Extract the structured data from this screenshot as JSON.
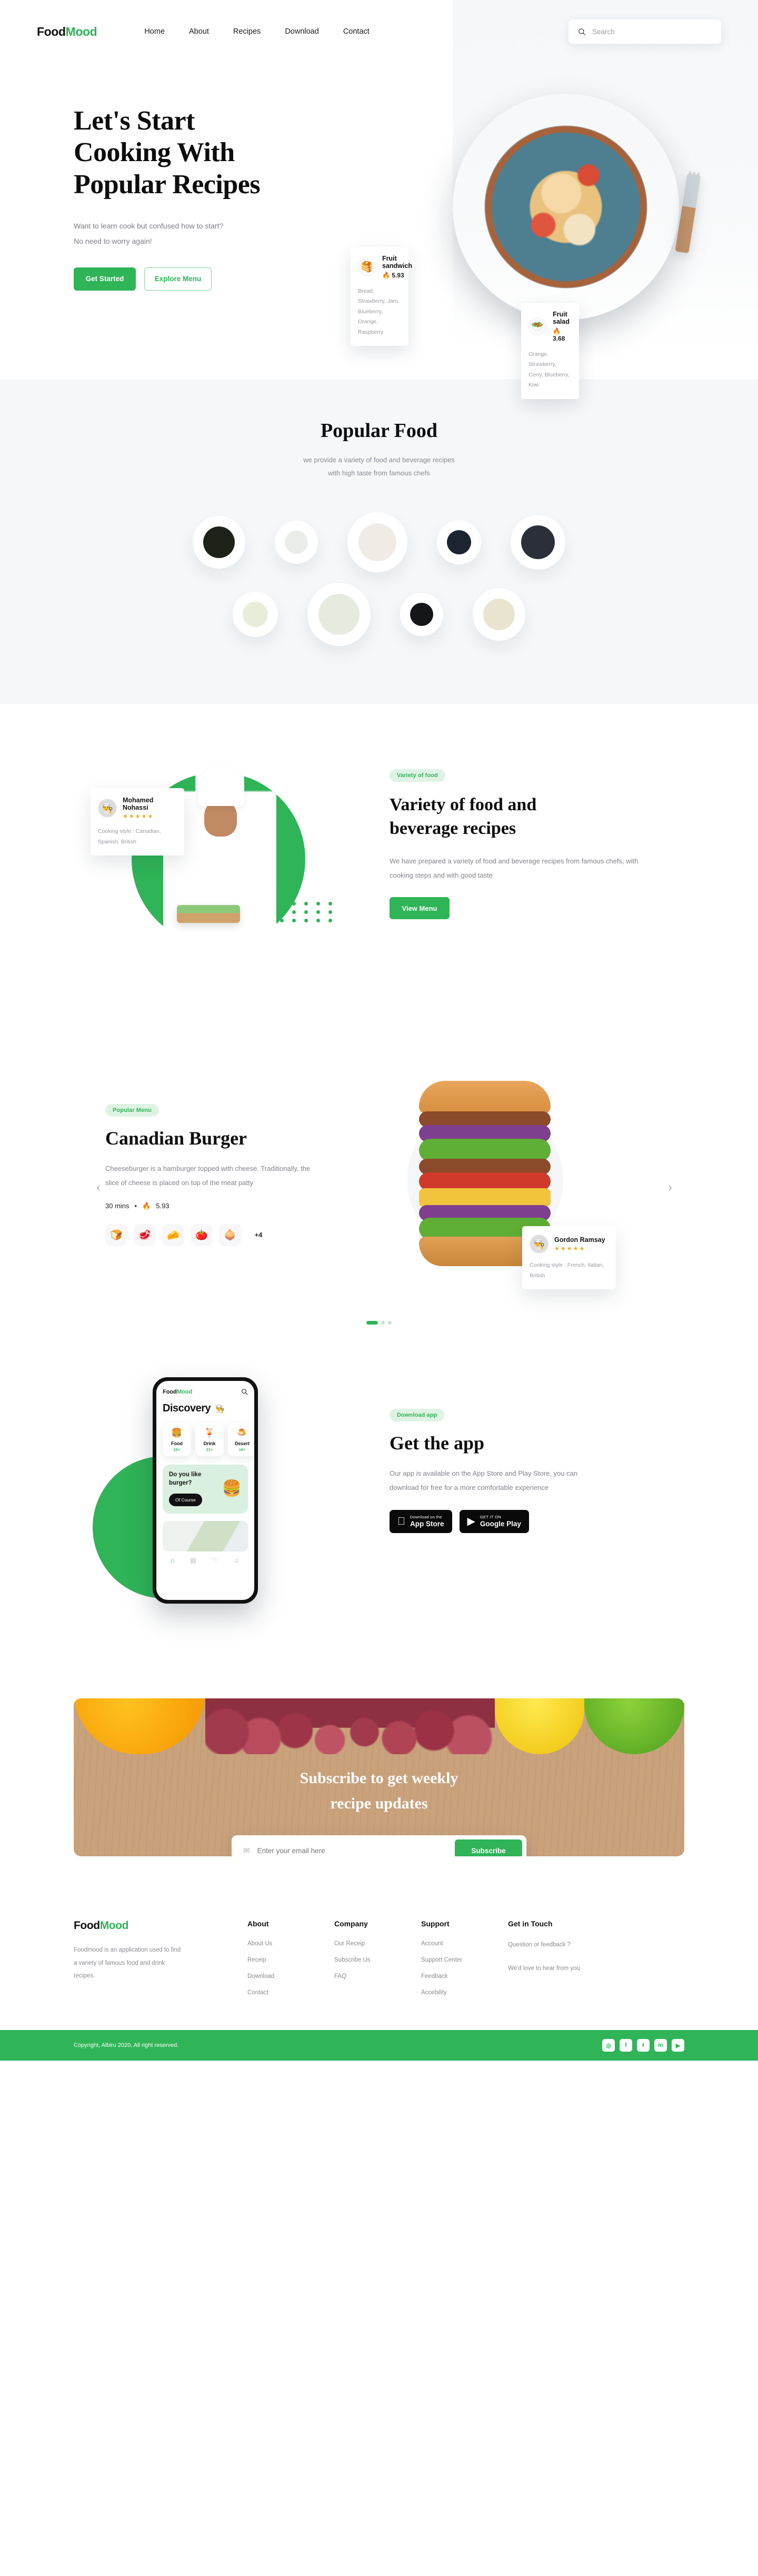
{
  "brand": {
    "part1": "Food",
    "part2": "Mood"
  },
  "nav": {
    "links": [
      "Home",
      "About",
      "Recipes",
      "Download",
      "Contact"
    ],
    "search_placeholder": "Search",
    "search_value": ""
  },
  "hero": {
    "title_line1": "Let's Start",
    "title_line2": "Cooking With",
    "title_line3": "Popular Recipes",
    "sub_line1": "Want to learn cook but confused how to start?",
    "sub_line2": "No need to worry again!",
    "primary_btn": "Get Started",
    "secondary_btn": "Explore Menu",
    "cards": [
      {
        "name": "Fruit sandwich",
        "rating": "5.93",
        "emoji": "🥞",
        "ingredients": "Bread, Strawberry, Jam, Blueberry, Orange, Raspberry"
      },
      {
        "name": "Fruit salad",
        "rating": "3.68",
        "emoji": "🥗",
        "ingredients": "Orange, Strawberry, Cerry, Blueberry, Kiwi"
      }
    ]
  },
  "popular": {
    "title": "Popular Food",
    "sub_line1": "we provide a variety of food and beverage recipes",
    "sub_line2": "with high taste from famous chefs",
    "row1": [
      {
        "name": "green-salad-dark-plate",
        "size": 72,
        "bg": "#1d2318",
        "size_inner": 60
      },
      {
        "name": "egg-salad-toast-plate",
        "size": 54,
        "bg": "#e9ece7",
        "size_inner": 44
      },
      {
        "name": "fig-fruit-plate",
        "size": 86,
        "bg": "#f0ece5",
        "size_inner": 72
      },
      {
        "name": "lentil-veg-bowl",
        "size": 56,
        "bg": "#1b2430",
        "size_inner": 46
      },
      {
        "name": "charcuterie-grape-plate",
        "size": 76,
        "bg": "#2a2f38",
        "size_inner": 64
      }
    ],
    "row2": [
      {
        "name": "avocado-cucumber-bowl",
        "size": 58,
        "bg": "#e7edd9",
        "size_inner": 48
      },
      {
        "name": "rainbow-veg-bowl",
        "size": 92,
        "bg": "#e6ebdf",
        "size_inner": 78
      },
      {
        "name": "waffle-dark-plate",
        "size": 54,
        "bg": "#14161a",
        "size_inner": 44
      },
      {
        "name": "stir-fry-noodles-plate",
        "size": 72,
        "bg": "#e8e4cf",
        "size_inner": 60
      }
    ]
  },
  "variety": {
    "badge": "Variety of food",
    "title_line1": "Variety of food and",
    "title_line2": "beverage recipes",
    "body": "We have prepared a variety of food and beverage recipes from famous chefs, with cooking steps and with good taste",
    "cta": "View Menu",
    "chef_card": {
      "name": "Mohamed Nohassi",
      "stars": "★★★★★",
      "cooking_style": "Cooking style : Canadian, Spanish, British",
      "avatar_emoji": "👨‍🍳"
    }
  },
  "burger": {
    "badge": "Popular Menu",
    "title": "Canadian Burger",
    "body": "Cheeseburger is a hamburger topped with cheese. Traditionally, the slice of cheese is placed on top of the meat patty",
    "time": "30 mins",
    "separator": "•",
    "rating": "5.93",
    "flame": "🔥",
    "ingredients": [
      "🍞",
      "🥩",
      "🧀",
      "🍅",
      "🧅"
    ],
    "more_label": "+4",
    "prev_arrow": "‹",
    "next_arrow": "›",
    "chef_card": {
      "name": "Gordon Ramsay",
      "stars": "★★★★★",
      "cooking_style": "Cooking style : French, Italian, British",
      "avatar_emoji": "👨‍🍳"
    },
    "slide_count": 3,
    "active_slide": 1
  },
  "getapp": {
    "badge": "Download app",
    "title": "Get the app",
    "body": "Our app is available on the App Store and Play Store, you can download for free for a more comfortable experience",
    "appstore": {
      "small": "Download on the",
      "large": "App Store",
      "glyph": ""
    },
    "playstore": {
      "small": "GET IT ON",
      "large": "Google Play"
    },
    "phone": {
      "logo1": "Food",
      "logo2": "Mood",
      "search_icon": "⌕",
      "heading": "Discovery",
      "heading_emoji": "👨‍🍳",
      "categories": [
        {
          "emoji": "🍔",
          "label": "Food",
          "count": "15+"
        },
        {
          "emoji": "🍹",
          "label": "Drink",
          "count": "21+"
        },
        {
          "emoji": "🍮",
          "label": "Desert",
          "count": "19+"
        }
      ],
      "banner_title": "Do you like burger?",
      "banner_btn": "Of Course",
      "banner_emoji": "🍔",
      "nav_icons": [
        "⌂",
        "▤",
        "♡",
        "☺"
      ]
    }
  },
  "subscribe": {
    "title_line1": "Subscribe to get weekly",
    "title_line2": "recipe updates",
    "mail_icon": "✉",
    "placeholder": "Enter your email here",
    "value": "",
    "button": "Subscribe"
  },
  "footer": {
    "description": "Foodmood is an application used to find a variety of famous food and drink recipes.",
    "columns": [
      {
        "title": "About",
        "links": [
          "About Us",
          "Receip",
          "Download",
          "Contact"
        ]
      },
      {
        "title": "Company",
        "links": [
          "Our Receip",
          "Subscribe Us",
          "FAQ"
        ]
      },
      {
        "title": "Support",
        "links": [
          "Account",
          "Support Center",
          "Feedback",
          "Accebility"
        ]
      }
    ],
    "touch": {
      "title": "Get in Touch",
      "line1": "Question or feedback ?",
      "line2": "We'd love to hear from you"
    },
    "copyright": "Copyright, Albiru 2020, All right reserved.",
    "socials": [
      "◎",
      "f",
      "ŧ",
      "in",
      "▶"
    ]
  },
  "colors": {
    "accent": "#2fb457",
    "accent_soft": "#dff3e4",
    "dark": "#101010",
    "muted": "#8b8b92"
  }
}
